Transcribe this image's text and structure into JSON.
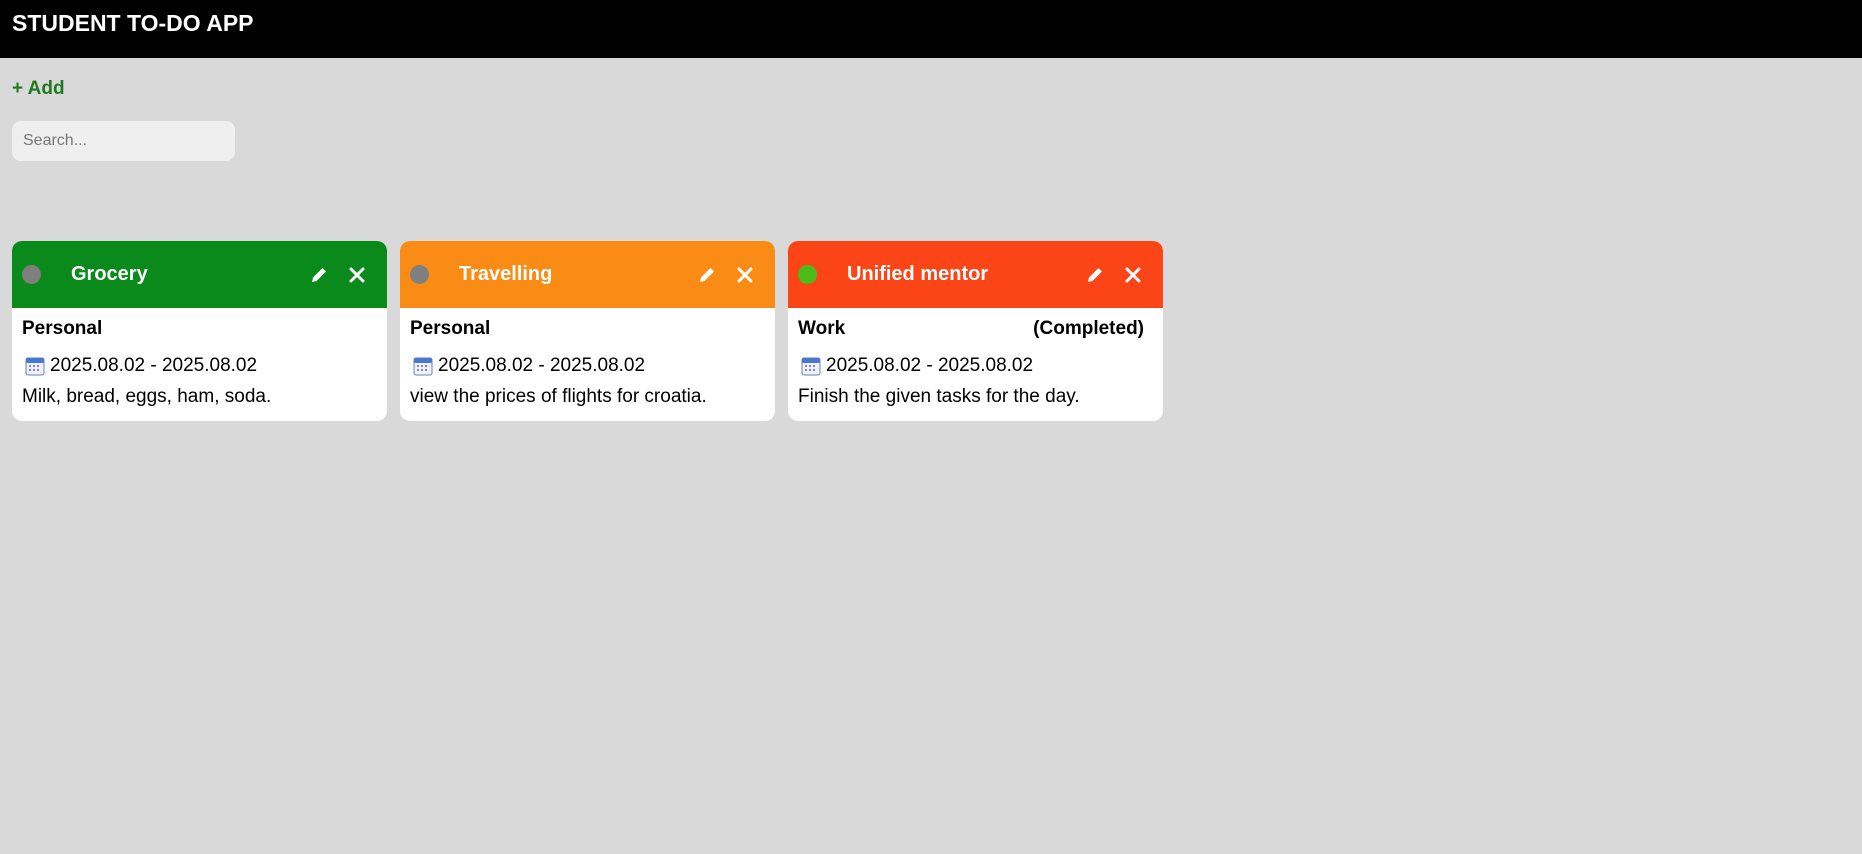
{
  "app": {
    "title": "STUDENT TO-DO APP"
  },
  "toolbar": {
    "add_label": "+ Add"
  },
  "search": {
    "placeholder": "Search...",
    "value": ""
  },
  "cards": [
    {
      "title": "Grocery",
      "header_color": "#0b8a1c",
      "status_dot_color": "#7f7f7f",
      "category": "Personal",
      "status": "",
      "dates": "2025.08.02 - 2025.08.02",
      "description": "Milk, bread, eggs, ham, soda.",
      "icons": [
        "status-dot-icon",
        "pencil-icon",
        "close-icon",
        "calendar-icon"
      ]
    },
    {
      "title": "Travelling",
      "header_color": "#fa8c16",
      "status_dot_color": "#7f7f7f",
      "category": "Personal",
      "status": "",
      "dates": "2025.08.02 - 2025.08.02",
      "description": "view the prices of flights for croatia.",
      "icons": [
        "status-dot-icon",
        "pencil-icon",
        "close-icon",
        "calendar-icon"
      ]
    },
    {
      "title": "Unified mentor",
      "header_color": "#fc4516",
      "status_dot_color": "#4cbb17",
      "category": "Work",
      "status": "(Completed)",
      "dates": "2025.08.02 - 2025.08.02",
      "description": "Finish the given tasks for the day.",
      "icons": [
        "status-dot-icon",
        "pencil-icon",
        "close-icon",
        "calendar-icon"
      ]
    }
  ],
  "colors": {
    "topbar": "#000000",
    "background": "#d9d9d9",
    "add_link": "#1f7a1f"
  }
}
